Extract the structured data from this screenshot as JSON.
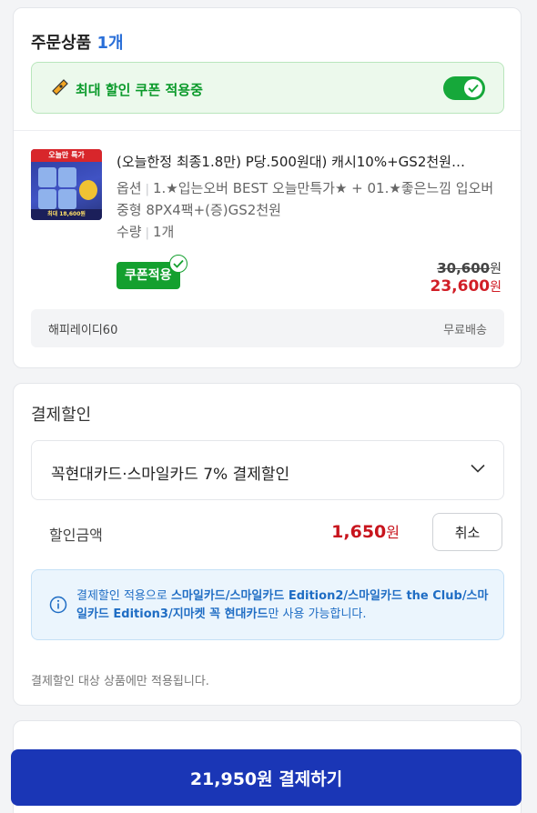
{
  "order": {
    "title": "주문상품",
    "count": "1개",
    "coupon_banner": "최대 할인 쿠폰 적용중",
    "product": {
      "name": "(오늘한정 최종1.8만) P당.500원대) 캐시10%+GS2천원…",
      "option_label": "옵션",
      "option_value": "1.★입는오버 BEST 오늘만특가★ + 01.★좋은느낌 입오버 중형 8PX4팩+(증)GS2천원",
      "qty_label": "수량",
      "qty_value": "1개",
      "thumb_band": "오늘만 특가",
      "thumb_price": "최대 18,600원"
    },
    "coupon_badge": "쿠폰적용",
    "price_original": "30,600",
    "price_final": "23,600",
    "currency": "원",
    "seller": "해피레이디60",
    "shipping": "무료배송"
  },
  "payment_discount": {
    "title": "결제할인",
    "selected": "꼭현대카드·스마일카드 7% 결제할인",
    "amount_label": "할인금액",
    "amount": "1,650",
    "cancel": "취소",
    "info_prefix": "결제할인 적용으로 ",
    "info_bold": "스마일카드/스마일카드 Edition2/스마일카드 the Club/스마일카드 Edition3/지마켓 꼭 현대카드",
    "info_suffix": "만 사용 가능합니다.",
    "footnote": "결제할인 대상 상품에만 적용됩니다."
  },
  "checkout": {
    "amount": "21,950원",
    "label": "결제하기"
  },
  "colors": {
    "accent_blue": "#1a36b6",
    "coupon_green": "#14a02f",
    "sale_red": "#d11e26"
  }
}
